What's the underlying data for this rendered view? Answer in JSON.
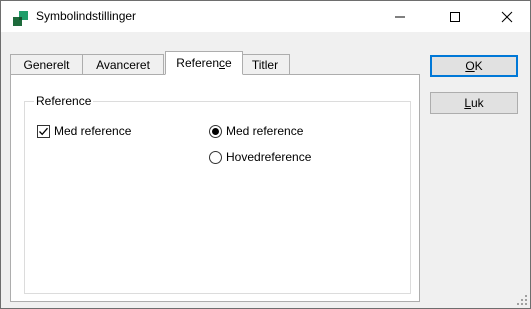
{
  "window": {
    "title": "Symbolindstillinger",
    "icon": "app-icon",
    "caption_buttons": {
      "minimize_icon": "minimize-icon",
      "maximize_icon": "maximize-icon",
      "close_icon": "close-icon"
    }
  },
  "tabs": [
    {
      "label": "Generelt",
      "active": false
    },
    {
      "label": "Avanceret",
      "active": false
    },
    {
      "label_pre": "Referen",
      "label_mnemonic": "c",
      "label_post": "e",
      "active": true
    },
    {
      "label": "Titler",
      "active": false
    }
  ],
  "reference_group": {
    "legend": "Reference",
    "checkbox": {
      "label": "Med reference",
      "checked": true
    },
    "radios": [
      {
        "label": "Med reference",
        "selected": true
      },
      {
        "label": "Hovedreference",
        "selected": false
      }
    ]
  },
  "buttons": {
    "ok": {
      "mnemonic": "O",
      "rest": "K"
    },
    "luk": {
      "mnemonic": "L",
      "rest": "uk"
    }
  },
  "colors": {
    "accent": "#0078d7",
    "dialog_bg": "#f0f0f0",
    "icon_dark": "#1e6b3c",
    "icon_light": "#1f9e6a"
  }
}
